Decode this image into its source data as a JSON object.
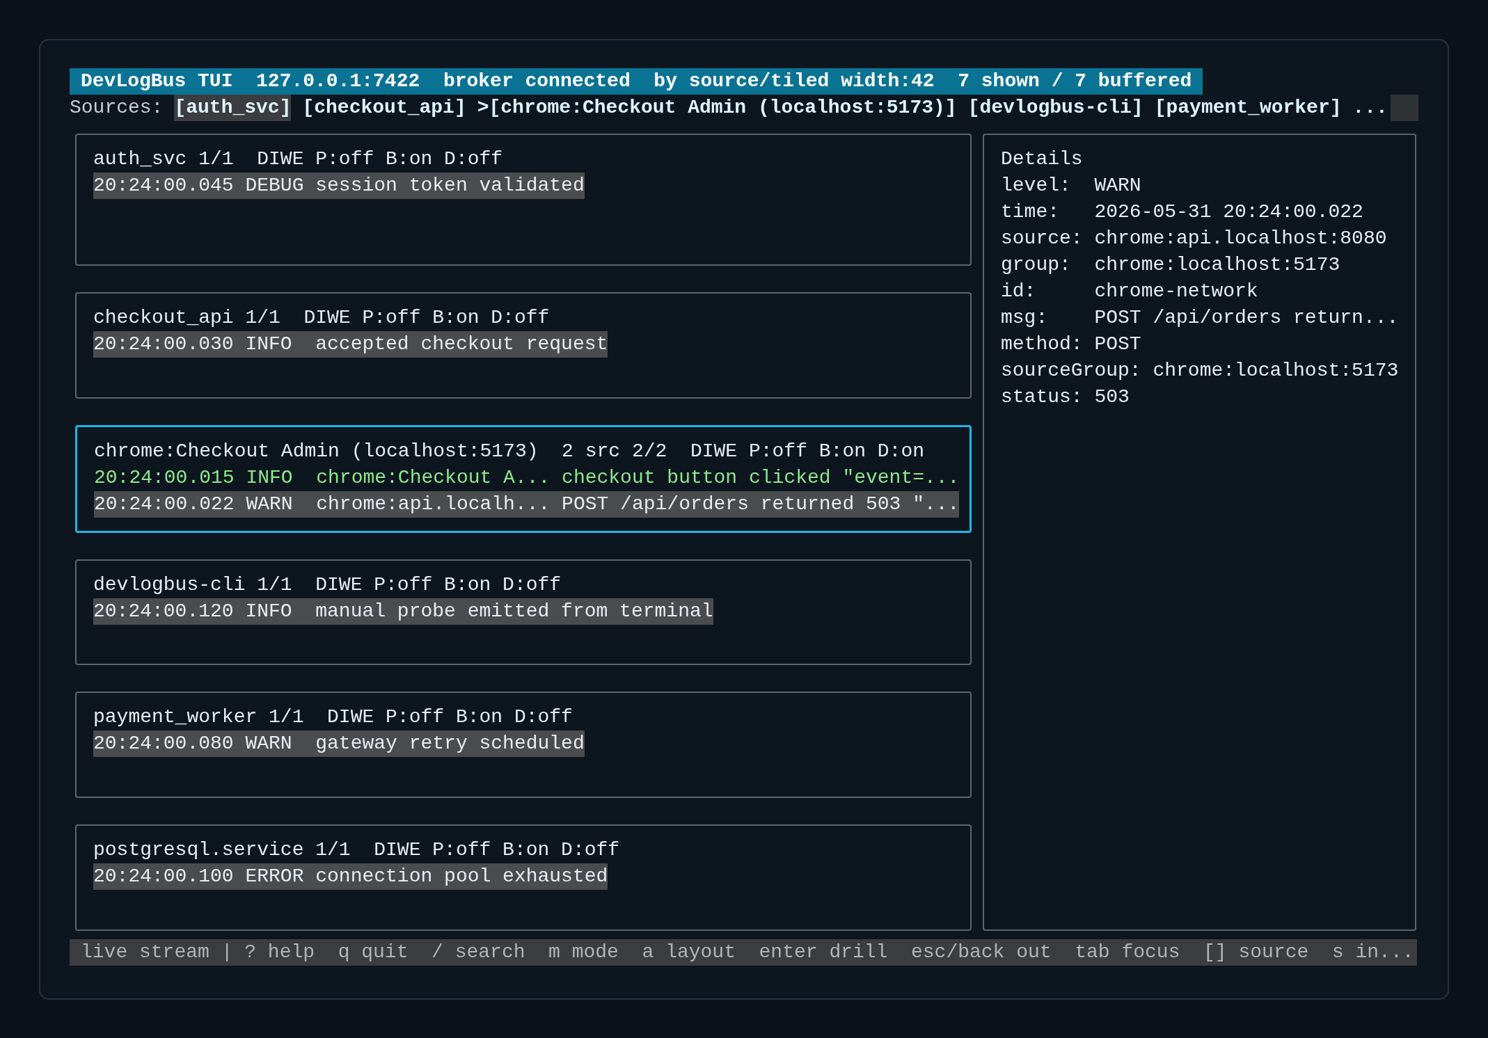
{
  "header": {
    "title": "DevLogBus TUI  127.0.0.1:7422  broker connected  by source/tiled width:42  7 shown / 7 buffered"
  },
  "sources": {
    "label": "Sources:",
    "more": "...",
    "items": [
      {
        "label": "[auth_svc]",
        "selected": true
      },
      {
        "label": "[checkout_api]",
        "selected": false
      },
      {
        "label": ">[chrome:Checkout Admin (localhost:5173)]",
        "selected": false
      },
      {
        "label": "[devlogbus-cli]",
        "selected": false
      },
      {
        "label": "[payment_worker]",
        "selected": false
      }
    ]
  },
  "panels": [
    {
      "title": "auth_svc 1/1  DIWE P:off B:on D:off",
      "focused": false,
      "lines": [
        {
          "text": "20:24:00.045 DEBUG session token validated",
          "highlighted": true,
          "kind": "plain"
        }
      ]
    },
    {
      "title": "checkout_api 1/1  DIWE P:off B:on D:off",
      "focused": false,
      "lines": [
        {
          "text": "20:24:00.030 INFO  accepted checkout request",
          "highlighted": true,
          "kind": "plain"
        }
      ]
    },
    {
      "title": "chrome:Checkout Admin (localhost:5173)  2 src 2/2  DIWE P:off B:on D:on",
      "focused": true,
      "lines": [
        {
          "text": "20:24:00.015 INFO  chrome:Checkout A... checkout button clicked \"event=...",
          "highlighted": false,
          "kind": "match"
        },
        {
          "text": "20:24:00.022 WARN  chrome:api.localh... POST /api/orders returned 503 \"...",
          "highlighted": true,
          "kind": "plain"
        }
      ]
    },
    {
      "title": "devlogbus-cli 1/1  DIWE P:off B:on D:off",
      "focused": false,
      "lines": [
        {
          "text": "20:24:00.120 INFO  manual probe emitted from terminal",
          "highlighted": true,
          "kind": "plain"
        }
      ]
    },
    {
      "title": "payment_worker 1/1  DIWE P:off B:on D:off",
      "focused": false,
      "lines": [
        {
          "text": "20:24:00.080 WARN  gateway retry scheduled",
          "highlighted": true,
          "kind": "plain"
        }
      ]
    },
    {
      "title": "postgresql.service 1/1  DIWE P:off B:on D:off",
      "focused": false,
      "lines": [
        {
          "text": "20:24:00.100 ERROR connection pool exhausted",
          "highlighted": true,
          "kind": "plain"
        }
      ]
    }
  ],
  "details": {
    "title": "Details",
    "fields": [
      {
        "label": "level:",
        "value": "WARN"
      },
      {
        "label": "time:",
        "value": "2026-05-31 20:24:00.022"
      },
      {
        "label": "source:",
        "value": "chrome:api.localhost:8080"
      },
      {
        "label": "group:",
        "value": "chrome:localhost:5173"
      },
      {
        "label": "id:",
        "value": "chrome-network"
      },
      {
        "label": "msg:",
        "value": "POST /api/orders return..."
      },
      {
        "label": "method:",
        "value": "POST"
      },
      {
        "label": "sourceGroup:",
        "value": "chrome:localhost:5173"
      },
      {
        "label": "status:",
        "value": "503"
      }
    ]
  },
  "status_bar": {
    "text": "live stream | ? help  q quit  / search  m mode  a layout  enter drill  esc/back out  tab focus  [] source  s in..."
  }
}
